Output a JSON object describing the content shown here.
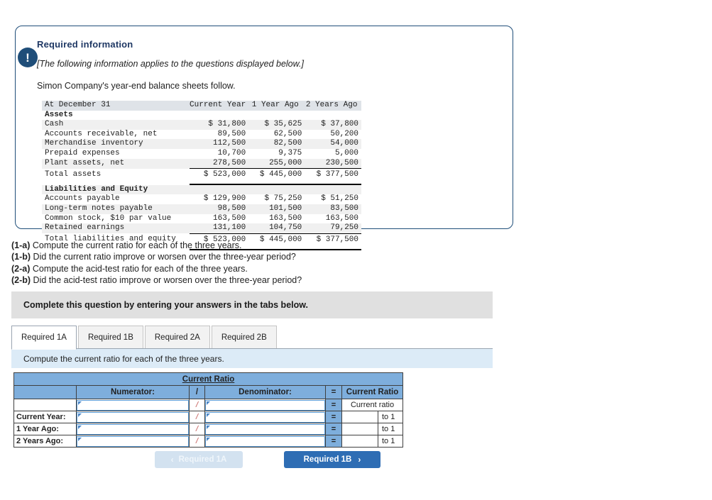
{
  "callout": {
    "icon": "exclamation-icon",
    "title": "Required information",
    "italic_note": "[The following information applies to the questions displayed below.]",
    "intro": "Simon Company's year-end balance sheets follow."
  },
  "balance_sheet": {
    "columns": [
      "At December 31",
      "Current Year",
      "1 Year Ago",
      "2 Years Ago"
    ],
    "sections": [
      {
        "heading": "Assets",
        "rows": [
          {
            "label": "Cash",
            "values": [
              "$ 31,800",
              "$ 35,625",
              "$ 37,800"
            ]
          },
          {
            "label": "Accounts receivable, net",
            "values": [
              "89,500",
              "62,500",
              "50,200"
            ]
          },
          {
            "label": "Merchandise inventory",
            "values": [
              "112,500",
              "82,500",
              "54,000"
            ]
          },
          {
            "label": "Prepaid expenses",
            "values": [
              "10,700",
              "9,375",
              "5,000"
            ]
          },
          {
            "label": "Plant assets, net",
            "values": [
              "278,500",
              "255,000",
              "230,500"
            ]
          }
        ],
        "total": {
          "label": "Total assets",
          "values": [
            "$ 523,000",
            "$ 445,000",
            "$ 377,500"
          ]
        }
      },
      {
        "heading": "Liabilities and Equity",
        "rows": [
          {
            "label": "Accounts payable",
            "values": [
              "$ 129,900",
              "$ 75,250",
              "$ 51,250"
            ]
          },
          {
            "label": "Long-term notes payable",
            "values": [
              "98,500",
              "101,500",
              "83,500"
            ]
          },
          {
            "label": "Common stock, $10 par value",
            "values": [
              "163,500",
              "163,500",
              "163,500"
            ]
          },
          {
            "label": "Retained earnings",
            "values": [
              "131,100",
              "104,750",
              "79,250"
            ]
          }
        ],
        "total": {
          "label": "Total liabilities and equity",
          "values": [
            "$ 523,000",
            "$ 445,000",
            "$ 377,500"
          ]
        }
      }
    ]
  },
  "questions": [
    {
      "num": "(1-a)",
      "text": " Compute the current ratio for each of the three years."
    },
    {
      "num": "(1-b)",
      "text": " Did the current ratio improve or worsen over the three-year period?"
    },
    {
      "num": "(2-a)",
      "text": " Compute the acid-test ratio for each of the three years."
    },
    {
      "num": "(2-b)",
      "text": " Did the acid-test ratio improve or worsen over the three-year period?"
    }
  ],
  "banner": {
    "text": "Complete this question by entering your answers in the tabs below."
  },
  "tabs": [
    {
      "label": "Required 1A",
      "active": true
    },
    {
      "label": "Required 1B",
      "active": false
    },
    {
      "label": "Required 2A",
      "active": false
    },
    {
      "label": "Required 2B",
      "active": false
    }
  ],
  "instruction": {
    "text": "Compute the current ratio for each of the three years."
  },
  "answer_table": {
    "title": "Current Ratio",
    "headers": [
      "",
      "Numerator:",
      "/",
      "Denominator:",
      "=",
      "Current Ratio"
    ],
    "note_row": {
      "slash": "/",
      "equals": "=",
      "note": "Current ratio"
    },
    "rows": [
      {
        "label": "Current Year:",
        "numerator": "",
        "slash": "/",
        "denominator": "",
        "equals": "=",
        "result": "",
        "suffix": "to 1"
      },
      {
        "label": "1 Year Ago:",
        "numerator": "",
        "slash": "/",
        "denominator": "",
        "equals": "=",
        "result": "",
        "suffix": "to 1"
      },
      {
        "label": "2 Years Ago:",
        "numerator": "",
        "slash": "/",
        "denominator": "",
        "equals": "=",
        "result": "",
        "suffix": "to 1"
      }
    ]
  },
  "nav": {
    "prev_label": "Required 1A",
    "prev_chevron": "‹",
    "next_label": "Required 1B",
    "next_chevron": "›"
  },
  "colors": {
    "callout_border": "#1f4e79",
    "badge": "#1f4e79",
    "table_header_blue": "#7eaedc",
    "instruction_bar": "#dcebf7",
    "banner_gray": "#e0e0e0",
    "next_button": "#2e6db4",
    "prev_button": "#d3e2f0"
  }
}
